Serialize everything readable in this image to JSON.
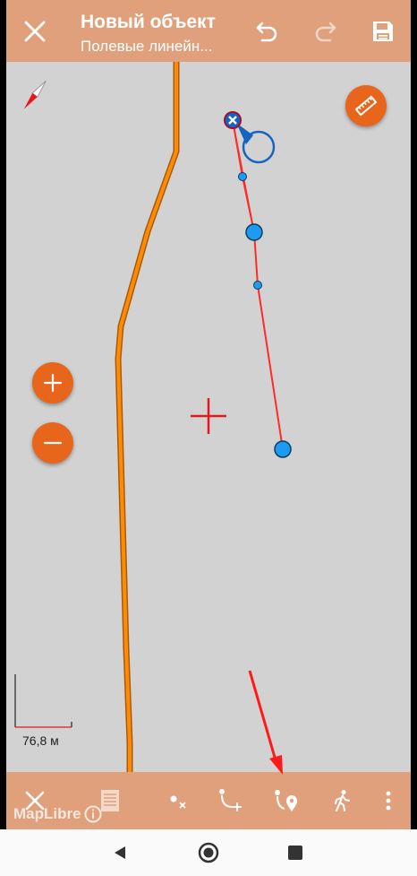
{
  "header": {
    "title": "Новый объект",
    "subtitle": "Полевые линейн...",
    "icons": [
      "close-icon",
      "undo-icon",
      "redo-icon",
      "save-icon"
    ]
  },
  "map": {
    "scale_label": "76,8 м",
    "attribution": "MapLibre",
    "accent_color": "#e8661c",
    "line_color": "#ff8c00",
    "edit_line_color": "#ff2a2a",
    "vertex_color": "#1e9bf0"
  },
  "toolbar": {
    "icons": [
      "close-icon",
      "layers-icon",
      "delete-point-icon",
      "add-point-icon",
      "add-point-gps-icon",
      "walk-mode-icon",
      "more-icon"
    ]
  },
  "system_nav": {
    "icons": [
      "back-icon",
      "home-icon",
      "recents-icon"
    ]
  }
}
